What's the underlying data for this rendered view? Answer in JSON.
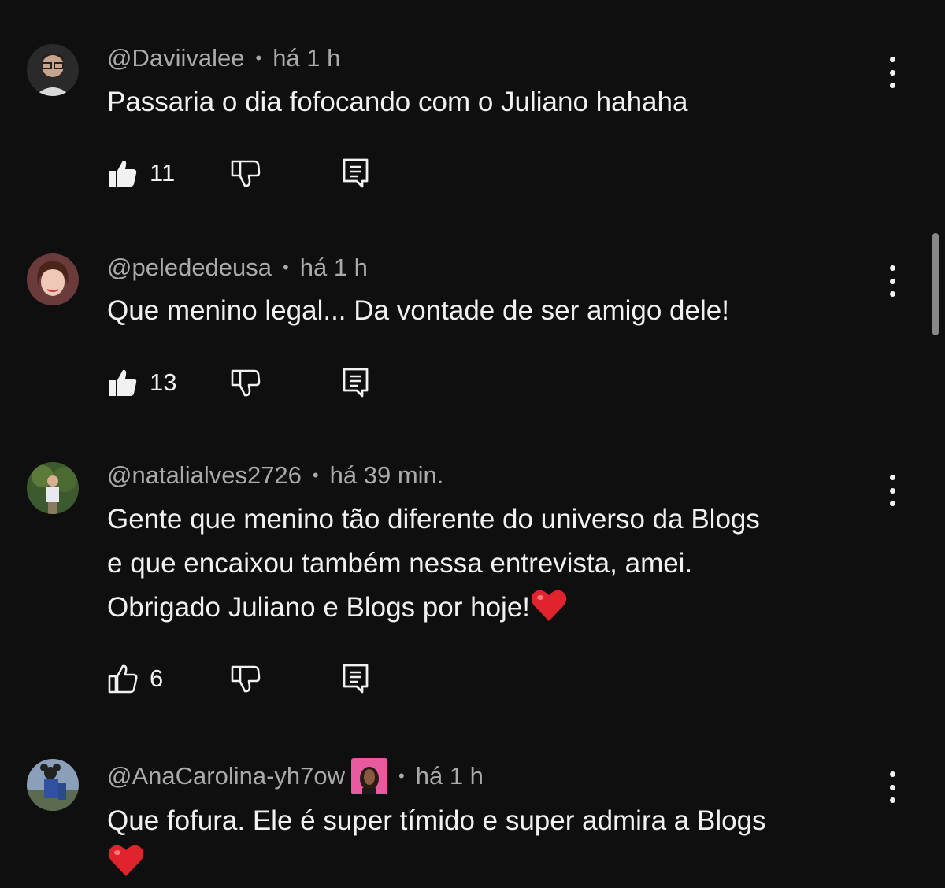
{
  "comments": [
    {
      "author": "@Daviivalee",
      "time": "há 1 h",
      "text": "Passaria o dia fofocando com o Juliano hahaha",
      "likes": "11",
      "liked": true
    },
    {
      "author": "@pelededeusa",
      "time": "há 1 h",
      "text": "Que menino legal... Da vontade de ser amigo dele!",
      "likes": "13",
      "liked": true
    },
    {
      "author": "@natalialves2726",
      "time": "há 39 min.",
      "text_lines": [
        "Gente que menino tão diferente do universo da Blogs",
        "e que encaixou também nessa entrevista, amei.",
        "Obrigado Juliano e Blogs por hoje!"
      ],
      "likes": "6",
      "liked": false
    },
    {
      "author": "@AnaCarolina-yh7ow",
      "time": "há 1 h",
      "text": "Que fofura. Ele é super tímido e super admira a Blogs"
    }
  ],
  "separator": "•",
  "icons": {
    "like": "thumbs-up-icon",
    "dislike": "thumbs-down-icon",
    "reply": "reply-comment-icon",
    "more": "more-vertical-icon",
    "heart": "red-heart-emoji"
  },
  "colors": {
    "background": "#0f0f0f",
    "text": "#f1f1f1",
    "meta": "#aaaaaa",
    "heart": "#e0242e"
  }
}
